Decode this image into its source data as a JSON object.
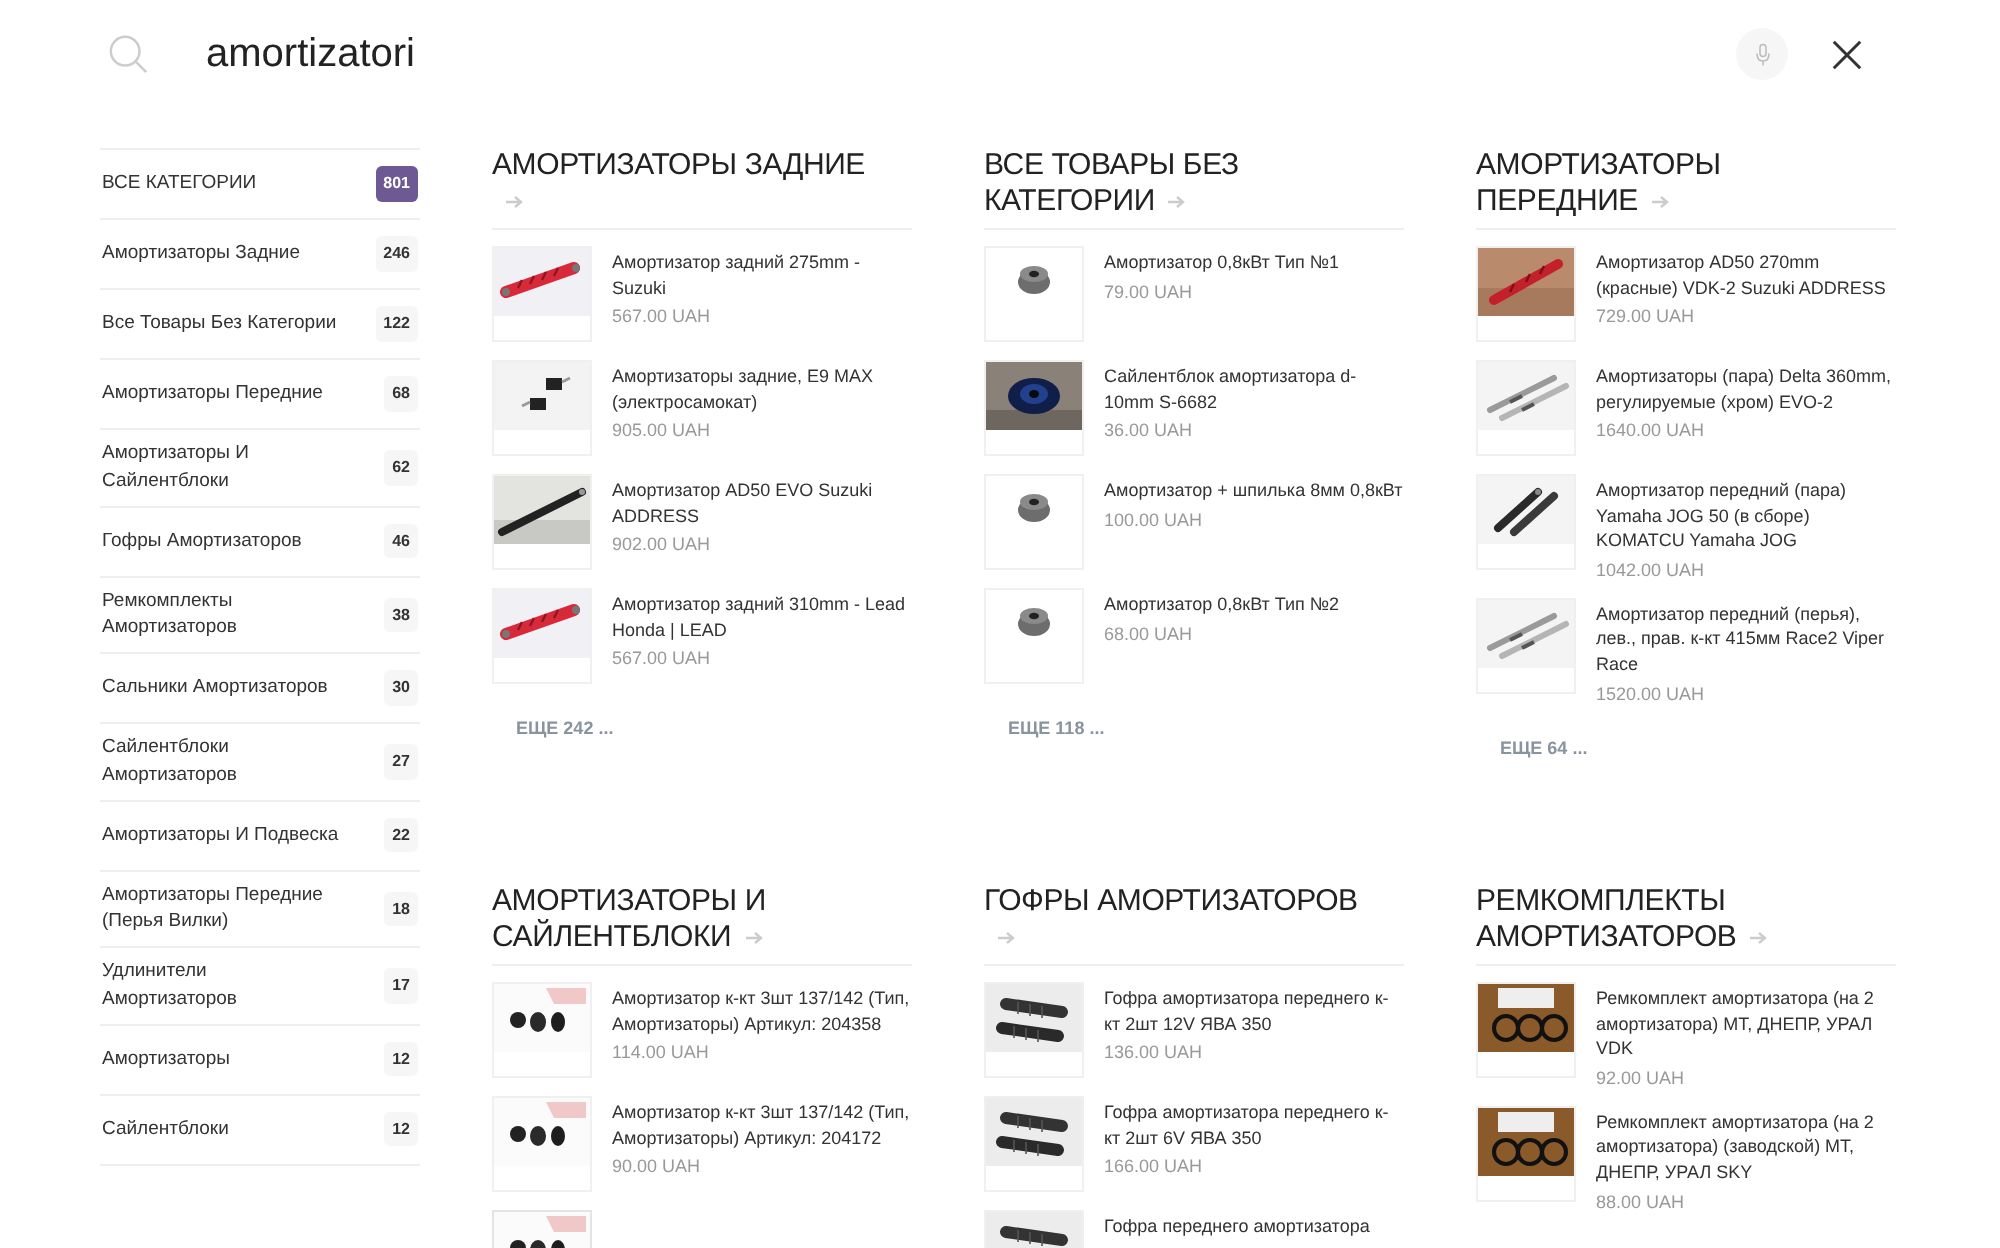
{
  "search": {
    "value": "amortizatori"
  },
  "categories": [
    {
      "label": "ВСЕ КАТЕГОРИИ",
      "count": "801",
      "selected": true
    },
    {
      "label": "Амортизаторы Задние",
      "count": "246",
      "selected": false
    },
    {
      "label": "Все Товары Без Категории",
      "count": "122",
      "selected": false
    },
    {
      "label": "Амортизаторы Передние",
      "count": "68",
      "selected": false
    },
    {
      "label": "Амортизаторы И Сайлентблоки",
      "count": "62",
      "selected": false
    },
    {
      "label": "Гофры Амортизаторов",
      "count": "46",
      "selected": false
    },
    {
      "label": "Ремкомплекты Амортизаторов",
      "count": "38",
      "selected": false
    },
    {
      "label": "Сальники Амортизаторов",
      "count": "30",
      "selected": false
    },
    {
      "label": "Сайлентблоки Амортизаторов",
      "count": "27",
      "selected": false
    },
    {
      "label": "Амортизаторы И Подвеска",
      "count": "22",
      "selected": false
    },
    {
      "label": "Амортизаторы Передние (Перья Вилки)",
      "count": "18",
      "selected": false
    },
    {
      "label": "Удлинители Амортизаторов",
      "count": "17",
      "selected": false
    },
    {
      "label": "Амортизаторы",
      "count": "12",
      "selected": false
    },
    {
      "label": "Сайлентблоки",
      "count": "12",
      "selected": false
    }
  ],
  "sections": [
    {
      "title": "АМОРТИЗАТОРЫ ЗАДНИЕ",
      "items": [
        {
          "name": "Амортизатор задний 275mm - Suzuki",
          "price": "567.00 UAH"
        },
        {
          "name": "Амортизаторы задние, E9 MAX (электросамокат)",
          "price": "905.00 UAH"
        },
        {
          "name": "Амортизатор AD50 EVO Suzuki ADDRESS",
          "price": "902.00 UAH"
        },
        {
          "name": "Амортизатор задний 310mm - Lead Honda | LEAD",
          "price": "567.00 UAH"
        }
      ],
      "more": "ЕЩЕ 242 ..."
    },
    {
      "title": "ВСЕ ТОВАРЫ БЕЗ КАТЕГОРИИ",
      "items": [
        {
          "name": "Амортизатор 0,8кВт Тип №1",
          "price": "79.00 UAH"
        },
        {
          "name": "Сайлентблок амортизатора d-10mm S-6682",
          "price": "36.00 UAH"
        },
        {
          "name": "Амортизатор + шпилька 8мм 0,8кВт",
          "price": "100.00 UAH"
        },
        {
          "name": "Амортизатор 0,8кВт Тип №2",
          "price": "68.00 UAH"
        }
      ],
      "more": "ЕЩЕ 118 ..."
    },
    {
      "title": "АМОРТИЗАТОРЫ ПЕРЕДНИЕ",
      "items": [
        {
          "name": "Амортизатор AD50 270mm (красные) VDK-2 Suzuki ADDRESS",
          "price": "729.00 UAH"
        },
        {
          "name": "Амортизаторы (пара) Delta 360mm, регулируемые (хром) EVO-2",
          "price": "1640.00 UAH"
        },
        {
          "name": "Амортизатор передний (пара) Yamaha JOG 50 (в сборе) KOMATCU Yamaha JOG",
          "price": "1042.00 UAH"
        },
        {
          "name": "Амортизатор передний (перья), лев., прав. к-кт 415мм Race2 Viper Race",
          "price": "1520.00 UAH"
        }
      ],
      "more": "ЕЩЕ 64 ..."
    },
    {
      "title": "АМОРТИЗАТОРЫ И САЙЛЕНТБЛОКИ",
      "items": [
        {
          "name": "Амортизатор к-кт 3шт 137/142 (Тип, Амортизаторы) Артикул: 204358",
          "price": "114.00 UAH"
        },
        {
          "name": "Амортизатор к-кт 3шт 137/142 (Тип, Амортизаторы) Артикул: 204172",
          "price": "90.00 UAH"
        },
        {
          "kind": "picture"
        }
      ]
    },
    {
      "title": "ГОФРЫ АМОРТИЗАТОРОВ",
      "items": [
        {
          "name": "Гофра амортизатора переднего к-кт 2шт 12V ЯВА 350",
          "price": "136.00 UAH"
        },
        {
          "name": "Гофра амортизатора переднего к-кт 2шт 6V ЯВА 350",
          "price": "166.00 UAH"
        },
        {
          "name": "Гофра переднего амортизатора"
        }
      ]
    },
    {
      "title": "РЕМКОМПЛЕКТЫ АМОРТИЗАТОРОВ",
      "items": [
        {
          "name": "Ремкомплект амортизатора (на 2 амортизатора) МТ, ДНЕПР, УРАЛ VDK",
          "price": "92.00 UAH"
        },
        {
          "name": "Ремкомплект амортизатора (на 2 амортизатора) (заводской) МТ, ДНЕПР, УРАЛ SKY",
          "price": "88.00 UAH"
        }
      ]
    }
  ]
}
